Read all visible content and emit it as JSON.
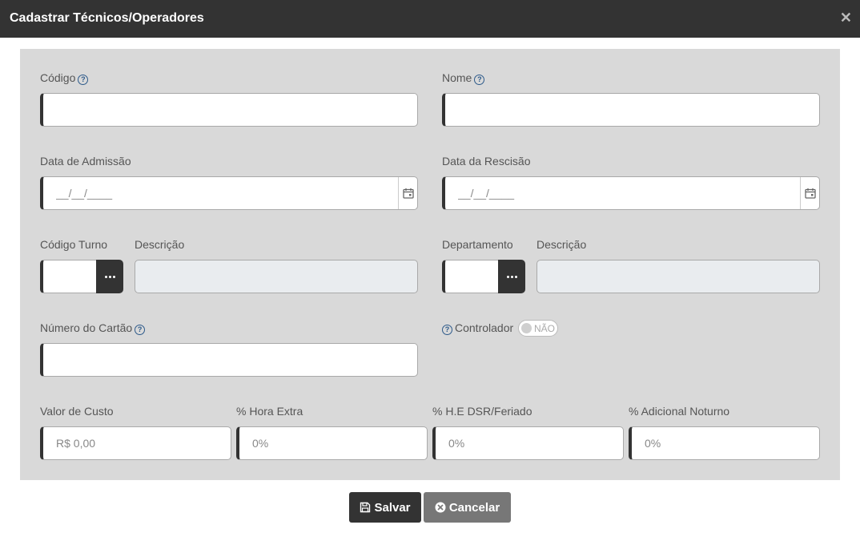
{
  "dialog": {
    "title": "Cadastrar Técnicos/Operadores"
  },
  "fields": {
    "codigo": {
      "label": "Código",
      "value": ""
    },
    "nome": {
      "label": "Nome",
      "value": ""
    },
    "data_admissao": {
      "label": "Data de Admissão",
      "placeholder": "__/__/____"
    },
    "data_rescisao": {
      "label": "Data da Rescisão",
      "placeholder": "__/__/____"
    },
    "codigo_turno": {
      "label": "Código Turno",
      "value": ""
    },
    "descricao_turno": {
      "label": "Descrição",
      "value": ""
    },
    "departamento": {
      "label": "Departamento",
      "value": ""
    },
    "descricao_departamento": {
      "label": "Descrição",
      "value": ""
    },
    "numero_cartao": {
      "label": "Número do Cartão",
      "value": ""
    },
    "controlador": {
      "label": "Controlador",
      "toggle_text": "NÃO",
      "checked": false
    },
    "valor_custo": {
      "label": "Valor de Custo",
      "placeholder": "R$ 0,00"
    },
    "hora_extra": {
      "label": "% Hora Extra",
      "placeholder": "0%"
    },
    "he_dsr": {
      "label": "% H.E DSR/Feriado",
      "placeholder": "0%"
    },
    "adicional_noturno": {
      "label": "% Adicional Noturno",
      "placeholder": "0%"
    }
  },
  "help_icon_glyph": "?",
  "buttons": {
    "save": "Salvar",
    "cancel": "Cancelar"
  },
  "colors": {
    "titlebar": "#333333",
    "panel": "#d9d9d9",
    "accent": "#333333",
    "help_icon": "#2d5a8a",
    "cancel": "#777777"
  },
  "icons": {
    "close": "close-icon",
    "help": "help-icon",
    "calendar": "calendar-icon",
    "lookup": "more-dots-icon",
    "save": "floppy-disk-icon",
    "cancel": "x-circle-icon"
  }
}
